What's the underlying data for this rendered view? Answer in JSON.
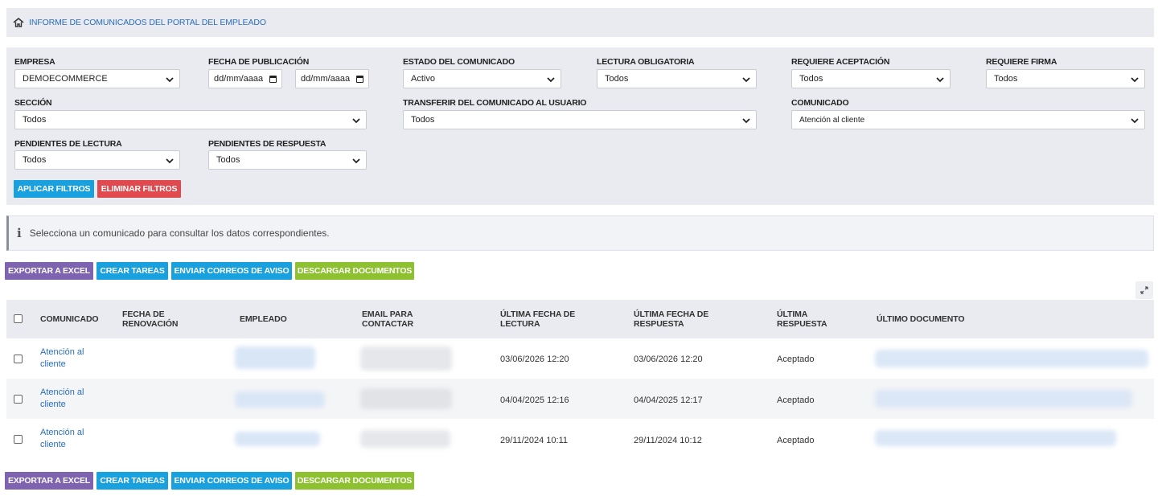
{
  "breadcrumb": {
    "title": "INFORME DE COMUNICADOS DEL PORTAL DEL EMPLEADO"
  },
  "filters": {
    "empresa": {
      "label": "EMPRESA",
      "value": "DEMOECOMMERCE"
    },
    "fecha_publicacion": {
      "label": "FECHA DE PUBLICACIÓN",
      "from_placeholder": "dd/mm/aaaa",
      "to_placeholder": "dd/mm/aaaa"
    },
    "estado": {
      "label": "ESTADO DEL COMUNICADO",
      "value": "Activo"
    },
    "lectura": {
      "label": "LECTURA OBLIGATORIA",
      "value": "Todos"
    },
    "aceptacion": {
      "label": "REQUIERE ACEPTACIÓN",
      "value": "Todos"
    },
    "firma": {
      "label": "REQUIERE FIRMA",
      "value": "Todos"
    },
    "seccion": {
      "label": "SECCIÓN",
      "value": "Todos"
    },
    "transferir": {
      "label": "TRANSFERIR DEL COMUNICADO AL USUARIO",
      "value": "Todos"
    },
    "comunicado": {
      "label": "COMUNICADO",
      "value": "Atención al cliente"
    },
    "pend_lectura": {
      "label": "PENDIENTES DE LECTURA",
      "value": "Todos"
    },
    "pend_respuesta": {
      "label": "PENDIENTES DE RESPUESTA",
      "value": "Todos"
    },
    "apply_label": "APLICAR FILTROS",
    "clear_label": "ELIMINAR FILTROS"
  },
  "info": {
    "text": "Selecciona un comunicado para consultar los datos correspondientes."
  },
  "actions": {
    "export": "EXPORTAR A EXCEL",
    "tasks": "CREAR TAREAS",
    "emails": "ENVIAR CORREOS DE AVISO",
    "docs": "DESCARGAR DOCUMENTOS"
  },
  "table": {
    "headers": {
      "comunicado": "COMUNICADO",
      "renovacion_1": "FECHA DE",
      "renovacion_2": "RENOVACIÓN",
      "empleado": "EMPLEADO",
      "email_1": "EMAIL PARA",
      "email_2": "CONTACTAR",
      "lectura_1": "ÚLTIMA FECHA DE",
      "lectura_2": "LECTURA",
      "respuesta_1": "ÚLTIMA FECHA DE",
      "respuesta_2": "RESPUESTA",
      "ultresp_1": "ÚLTIMA",
      "ultresp_2": "RESPUESTA",
      "documento": "ÚLTIMO DOCUMENTO"
    },
    "rows": [
      {
        "comunicado_1": "Atención al",
        "comunicado_2": "cliente",
        "lectura": "03/06/2026 12:20",
        "respuesta": "03/06/2026 12:20",
        "ultima_respuesta": "Aceptado"
      },
      {
        "comunicado_1": "Atención al",
        "comunicado_2": "cliente",
        "lectura": "04/04/2025 12:16",
        "respuesta": "04/04/2025 12:17",
        "ultima_respuesta": "Aceptado"
      },
      {
        "comunicado_1": "Atención al",
        "comunicado_2": "cliente",
        "lectura": "29/11/2024 10:11",
        "respuesta": "29/11/2024 10:12",
        "ultima_respuesta": "Aceptado"
      }
    ]
  },
  "colors": {
    "accent_blue": "#18a0df",
    "danger": "#e04a4e",
    "purple": "#7e63b0",
    "green": "#8ec12f",
    "link": "#2a6ebb"
  }
}
